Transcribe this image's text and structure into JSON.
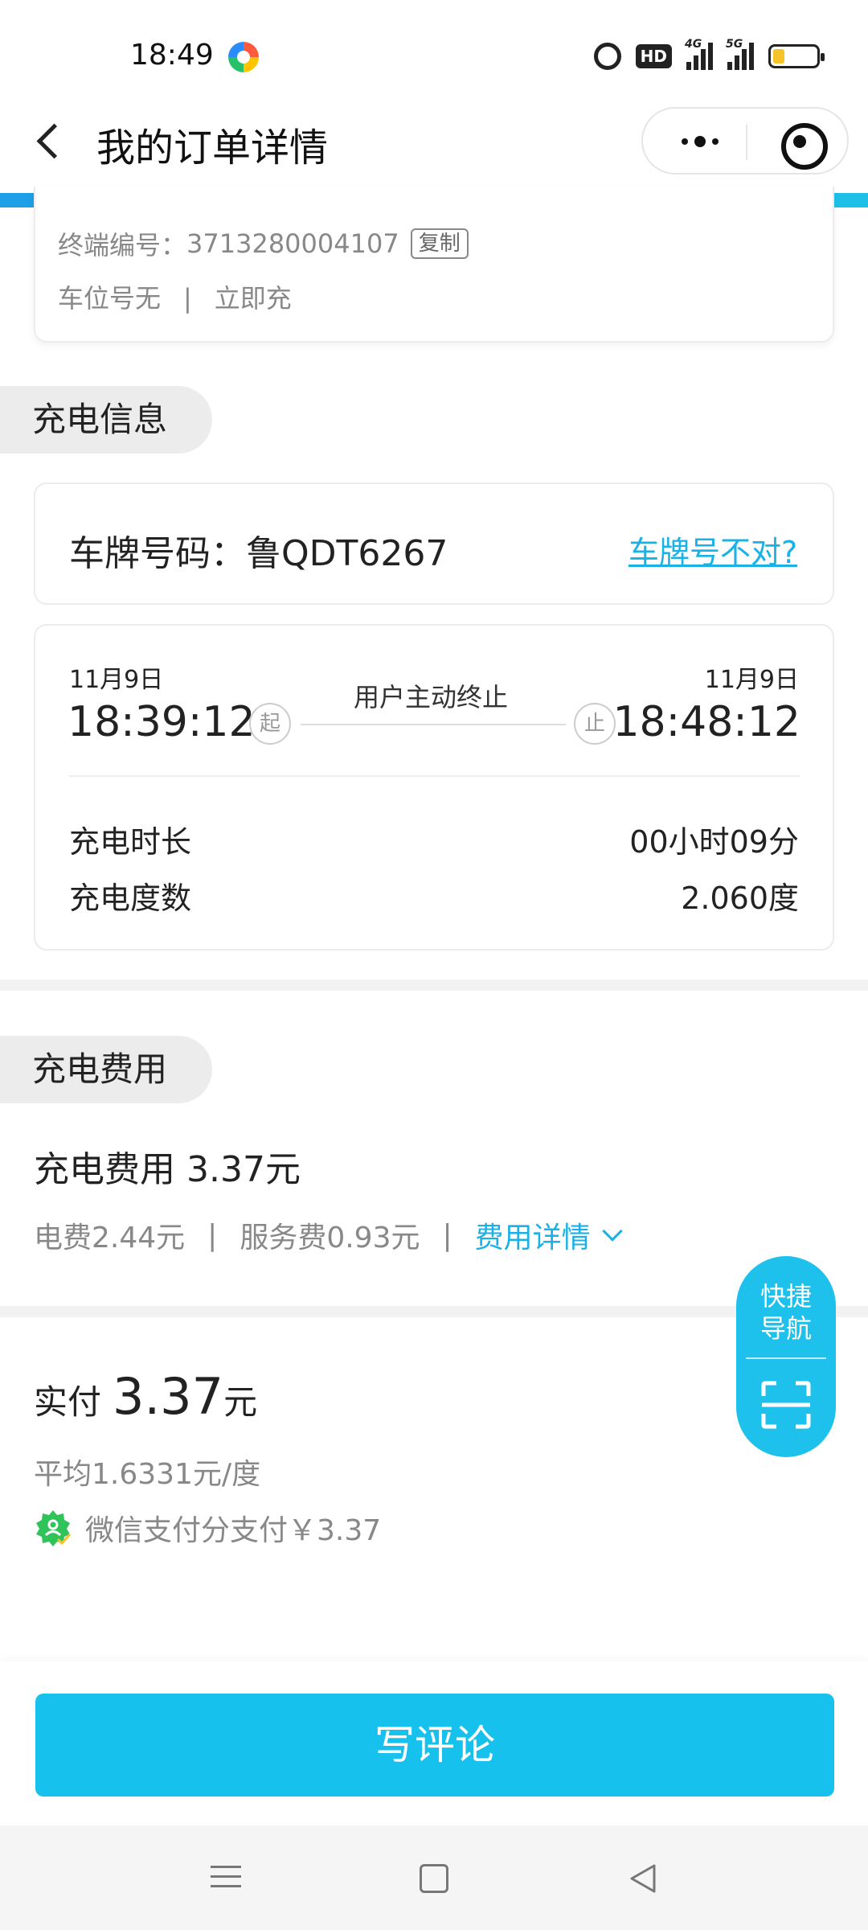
{
  "status_bar": {
    "time": "18:49",
    "hd_label": "HD",
    "signal_1": "4G",
    "signal_2": "5G",
    "icons": [
      "app-icon",
      "alarm-icon",
      "hd-icon",
      "signal-icon",
      "battery-icon"
    ]
  },
  "header": {
    "title": "我的订单详情",
    "icons": [
      "back-icon",
      "more-icon",
      "target-icon"
    ]
  },
  "terminal": {
    "label": "终端编号：",
    "number": "3713280004107",
    "copy_label": "复制",
    "spot": "车位号无",
    "separator": "|",
    "mode": "立即充"
  },
  "charge_info": {
    "section_title": "充电信息",
    "plate_label": "车牌号码：",
    "plate_number": "鲁QDT6267",
    "plate_fix_link": "车牌号不对?",
    "start_date": "11月9日",
    "start_time": "18:39:12",
    "start_tag": "起",
    "end_date": "11月9日",
    "end_time": "18:48:12",
    "end_tag": "止",
    "stop_reason": "用户主动终止",
    "duration_label": "充电时长",
    "duration_value": "00小时09分",
    "energy_label": "充电度数",
    "energy_value": "2.060度"
  },
  "fees": {
    "section_title": "充电费用",
    "total_label": "充电费用",
    "total_value": "3.37元",
    "electricity": "电费2.44元",
    "service": "服务费0.93元",
    "separator": "|",
    "detail_link": "费用详情"
  },
  "payment": {
    "paid_label": "实付",
    "paid_amount": "3.37",
    "paid_unit": "元",
    "average": "平均1.6331元/度",
    "method": "微信支付分支付￥3.37"
  },
  "quick_nav": {
    "label_line1": "快捷",
    "label_line2": "导航"
  },
  "actions": {
    "review_button": "写评论"
  },
  "colors": {
    "accent": "#17c1ed",
    "link": "#1ab2e6",
    "wechat_green": "#2fc35a"
  }
}
